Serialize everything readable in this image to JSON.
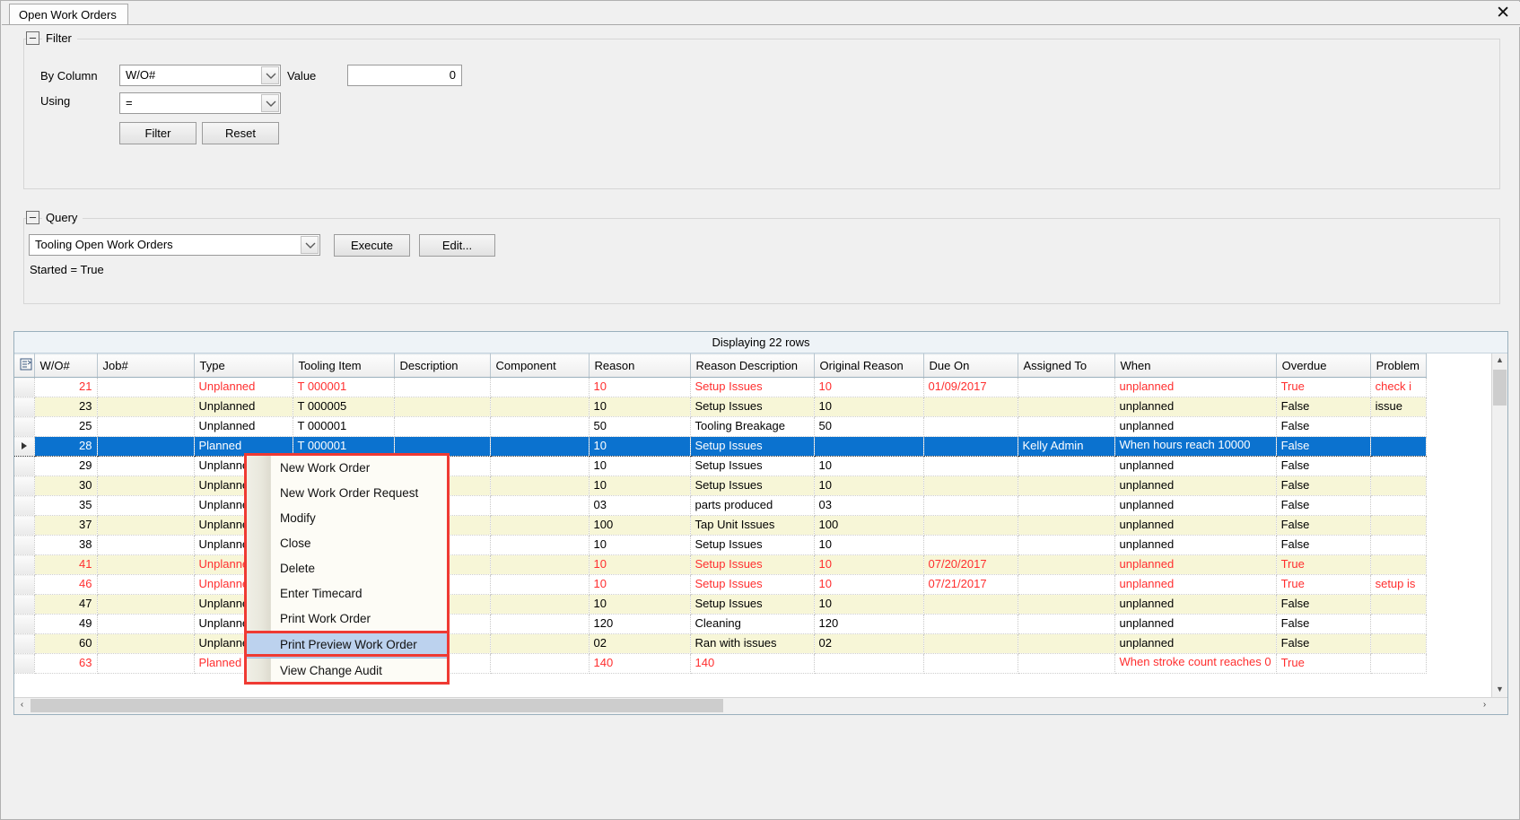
{
  "window": {
    "tab_label": "Open Work Orders",
    "close_icon": "close-icon"
  },
  "filter": {
    "title": "Filter",
    "collapse_glyph": "–",
    "by_column_label": "By Column",
    "by_column_value": "W/O#",
    "using_label": "Using",
    "using_value": "=",
    "value_label": "Value",
    "value_text": "0",
    "filter_button": "Filter",
    "reset_button": "Reset"
  },
  "query": {
    "title": "Query",
    "collapse_glyph": "–",
    "query_value": "Tooling Open Work Orders",
    "execute_button": "Execute",
    "edit_button": "Edit...",
    "status_text": "Started = True"
  },
  "grid": {
    "caption": "Displaying 22 rows",
    "columns": [
      "W/O#",
      "Job#",
      "Type",
      "Tooling Item",
      "Description",
      "Component",
      "Reason",
      "Reason Description",
      "Original Reason",
      "Due On",
      "Assigned To",
      "When",
      "Overdue",
      "Problem"
    ],
    "rows": [
      {
        "wo": "21",
        "job": "",
        "type": "Unplanned",
        "tooling": "T 000001",
        "desc": "",
        "component": "",
        "reason": "10",
        "reason_desc": "Setup Issues",
        "orig_reason": "10",
        "due_on": "01/09/2017",
        "assigned": "",
        "when": "unplanned",
        "overdue": "True",
        "problem": "check i",
        "red": true,
        "alt": false,
        "selected": false
      },
      {
        "wo": "23",
        "job": "",
        "type": "Unplanned",
        "tooling": "T 000005",
        "desc": "",
        "component": "",
        "reason": "10",
        "reason_desc": "Setup Issues",
        "orig_reason": "10",
        "due_on": "",
        "assigned": "",
        "when": "unplanned",
        "overdue": "False",
        "problem": "issue",
        "red": false,
        "alt": true,
        "selected": false
      },
      {
        "wo": "25",
        "job": "",
        "type": "Unplanned",
        "tooling": "T 000001",
        "desc": "",
        "component": "",
        "reason": "50",
        "reason_desc": "Tooling Breakage",
        "orig_reason": "50",
        "due_on": "",
        "assigned": "",
        "when": "unplanned",
        "overdue": "False",
        "problem": "",
        "red": false,
        "alt": false,
        "selected": false
      },
      {
        "wo": "28",
        "job": "",
        "type": "Planned",
        "tooling": "T 000001",
        "desc": "",
        "component": "",
        "reason": "10",
        "reason_desc": "Setup Issues",
        "orig_reason": "",
        "due_on": "",
        "assigned": "Kelly Admin",
        "when": "When hours reach 10000",
        "overdue": "False",
        "problem": "",
        "red": false,
        "alt": false,
        "selected": true
      },
      {
        "wo": "29",
        "job": "",
        "type": "Unplanned",
        "tooling": "",
        "desc": "",
        "component": "",
        "reason": "10",
        "reason_desc": "Setup Issues",
        "orig_reason": "10",
        "due_on": "",
        "assigned": "",
        "when": "unplanned",
        "overdue": "False",
        "problem": "",
        "red": false,
        "alt": false,
        "selected": false
      },
      {
        "wo": "30",
        "job": "",
        "type": "Unplanned",
        "tooling": "",
        "desc": "",
        "component": "",
        "reason": "10",
        "reason_desc": "Setup Issues",
        "orig_reason": "10",
        "due_on": "",
        "assigned": "",
        "when": "unplanned",
        "overdue": "False",
        "problem": "",
        "red": false,
        "alt": true,
        "selected": false
      },
      {
        "wo": "35",
        "job": "",
        "type": "Unplanned",
        "tooling": "",
        "desc": "",
        "component": "",
        "reason": "03",
        "reason_desc": "parts produced",
        "orig_reason": "03",
        "due_on": "",
        "assigned": "",
        "when": "unplanned",
        "overdue": "False",
        "problem": "",
        "red": false,
        "alt": false,
        "selected": false
      },
      {
        "wo": "37",
        "job": "",
        "type": "Unplanned",
        "tooling": "",
        "desc": "",
        "component": "",
        "reason": "100",
        "reason_desc": "Tap Unit Issues",
        "orig_reason": "100",
        "due_on": "",
        "assigned": "",
        "when": "unplanned",
        "overdue": "False",
        "problem": "",
        "red": false,
        "alt": true,
        "selected": false
      },
      {
        "wo": "38",
        "job": "",
        "type": "Unplanned",
        "tooling": "",
        "desc": "",
        "component": "",
        "reason": "10",
        "reason_desc": "Setup Issues",
        "orig_reason": "10",
        "due_on": "",
        "assigned": "",
        "when": "unplanned",
        "overdue": "False",
        "problem": "",
        "red": false,
        "alt": false,
        "selected": false
      },
      {
        "wo": "41",
        "job": "",
        "type": "Unplanned",
        "tooling": "",
        "desc": "",
        "component": "",
        "reason": "10",
        "reason_desc": "Setup Issues",
        "orig_reason": "10",
        "due_on": "07/20/2017",
        "assigned": "",
        "when": "unplanned",
        "overdue": "True",
        "problem": "",
        "red": true,
        "alt": true,
        "selected": false
      },
      {
        "wo": "46",
        "job": "",
        "type": "Unplanned",
        "tooling": "",
        "desc": "",
        "component": "",
        "reason": "10",
        "reason_desc": "Setup Issues",
        "orig_reason": "10",
        "due_on": "07/21/2017",
        "assigned": "",
        "when": "unplanned",
        "overdue": "True",
        "problem": "setup is",
        "red": true,
        "alt": false,
        "selected": false
      },
      {
        "wo": "47",
        "job": "",
        "type": "Unplanned",
        "tooling": "",
        "desc": "",
        "component": "",
        "reason": "10",
        "reason_desc": "Setup Issues",
        "orig_reason": "10",
        "due_on": "",
        "assigned": "",
        "when": "unplanned",
        "overdue": "False",
        "problem": "",
        "red": false,
        "alt": true,
        "selected": false
      },
      {
        "wo": "49",
        "job": "",
        "type": "Unplanned",
        "tooling": "",
        "desc": "",
        "component": "",
        "reason": "120",
        "reason_desc": "Cleaning",
        "orig_reason": "120",
        "due_on": "",
        "assigned": "",
        "when": "unplanned",
        "overdue": "False",
        "problem": "",
        "red": false,
        "alt": false,
        "selected": false
      },
      {
        "wo": "60",
        "job": "",
        "type": "Unplanned",
        "tooling": "",
        "desc": "",
        "component": "",
        "reason": "02",
        "reason_desc": "Ran with issues",
        "orig_reason": "02",
        "due_on": "",
        "assigned": "",
        "when": "unplanned",
        "overdue": "False",
        "problem": "",
        "red": false,
        "alt": true,
        "selected": false
      },
      {
        "wo": "63",
        "job": "",
        "type": "Planned",
        "tooling": "",
        "desc": "",
        "component": "",
        "reason": "140",
        "reason_desc": "140",
        "orig_reason": "",
        "due_on": "",
        "assigned": "",
        "when": "When stroke count reaches 0",
        "overdue": "True",
        "problem": "",
        "red": true,
        "alt": false,
        "selected": false
      }
    ]
  },
  "context_menu": {
    "items": [
      {
        "label": "New Work Order",
        "highlighted": false
      },
      {
        "label": "New Work Order Request",
        "highlighted": false
      },
      {
        "label": "Modify",
        "highlighted": false
      },
      {
        "label": "Close",
        "highlighted": false
      },
      {
        "label": "Delete",
        "highlighted": false
      },
      {
        "label": "Enter Timecard",
        "highlighted": false
      },
      {
        "label": "Print Work Order",
        "highlighted": false
      },
      {
        "label": "Print Preview Work Order",
        "highlighted": true
      },
      {
        "label": "View Change Audit",
        "highlighted": false
      }
    ]
  },
  "scrollbars": {
    "up_glyph": "▲",
    "down_glyph": "▼",
    "left_glyph": "‹",
    "right_glyph": "›"
  },
  "colors": {
    "selection": "#0b72cf",
    "alert_red": "#ff2f2f",
    "menu_highlight": "#bcd2ee",
    "annotation_red": "#ef3a33",
    "alt_row": "#f7f6d7"
  }
}
